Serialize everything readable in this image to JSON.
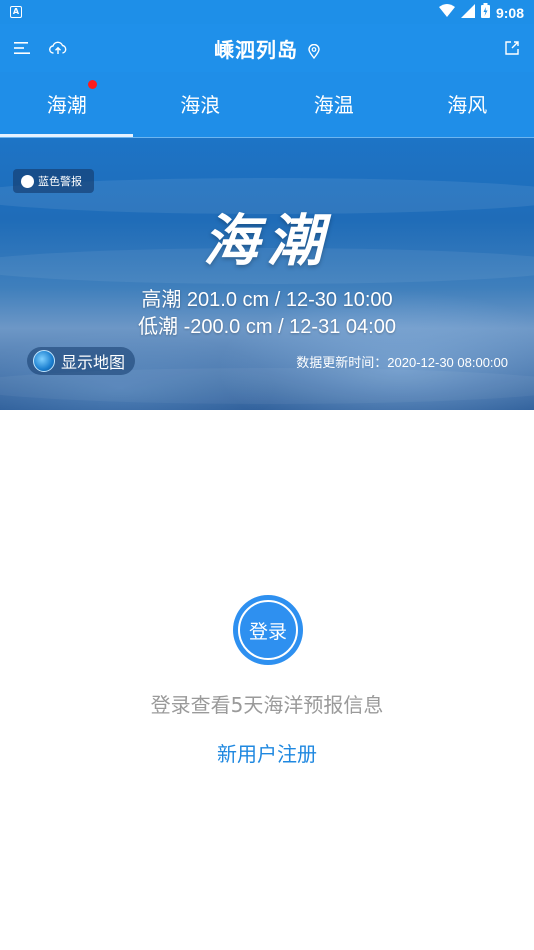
{
  "status_bar": {
    "app_indicator": "A",
    "time": "9:08",
    "icons": [
      "wifi-icon",
      "signal-icon",
      "battery-icon"
    ]
  },
  "app_bar": {
    "title": "嵊泗列岛",
    "icons": [
      "menu-icon",
      "cloud-upload-icon",
      "location-pin-icon",
      "share-icon"
    ]
  },
  "tabs": [
    {
      "label": "海潮",
      "selected": true,
      "has_notification_dot": true
    },
    {
      "label": "海浪",
      "selected": false
    },
    {
      "label": "海温",
      "selected": false
    },
    {
      "label": "海风",
      "selected": false
    }
  ],
  "banner": {
    "alert_badge": "蓝色警报",
    "heading": "海潮",
    "high_tide": "高潮 201.0 cm / 12-30 10:00",
    "low_tide": "低潮 -200.0 cm / 12-31 04:00",
    "map_button": "显示地图",
    "update_time": "数据更新时间：2020-12-30 08:00:00"
  },
  "login": {
    "button_label": "登录",
    "hint": "登录查看5天海洋预报信息",
    "register_link": "新用户注册"
  },
  "colors": {
    "primary": "#1f90ea",
    "accent_link": "#1f88e0",
    "notification_dot": "#ff1b1b",
    "hint_text": "#9a9a9a"
  }
}
